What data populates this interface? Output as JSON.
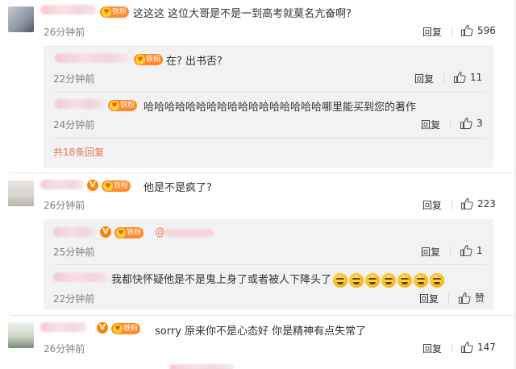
{
  "badge_v": "V",
  "badge_fan": "铁粉",
  "comments": [
    {
      "text": "这这这 这位大哥是不是一到高考就莫名亢奋啊?",
      "time": "26分钟前",
      "reply_label": "回复",
      "likes": "596",
      "replies": [
        {
          "text": "在? 出书否?",
          "time": "22分钟前",
          "reply_label": "回复",
          "likes": "11"
        },
        {
          "text": "哈哈哈哈哈哈哈哈哈哈哈哈哈哈哈哈哈哪里能买到您的著作",
          "time": "24分钟前",
          "reply_label": "回复",
          "likes": "3"
        }
      ],
      "more_replies": "共18条回复"
    },
    {
      "text": "他是不是疯了?",
      "time": "26分钟前",
      "reply_label": "回复",
      "likes": "223",
      "replies": [
        {
          "text": "@",
          "time": "25分钟前",
          "reply_label": "回复",
          "likes": "1"
        },
        {
          "text": "我都快怀疑他是不是鬼上身了或者被人下降头了",
          "time": "22分钟前",
          "reply_label": "回复",
          "likes": "赞"
        }
      ]
    },
    {
      "text": "sorry 原来你不是心态好 你是精神有点失常了",
      "time": "26分钟前",
      "reply_label": "回复",
      "likes": "147"
    }
  ],
  "colors": {
    "accent": "#eb7350",
    "badge": "#ff8200",
    "panel": "#f2f2f5"
  }
}
